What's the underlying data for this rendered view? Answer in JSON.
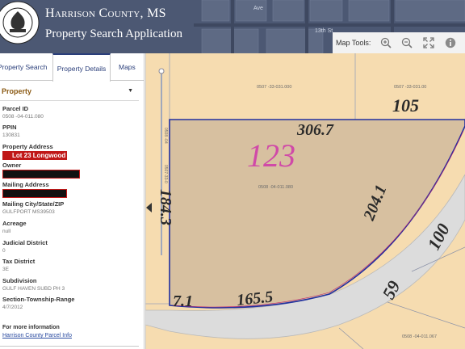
{
  "header": {
    "title": "Harrison County, MS",
    "subtitle": "Property Search Application",
    "seal_text": "BOARD OF SUPERVISORS · HARRISON COUNTY",
    "street_label": "13th St",
    "avenue_label": "Ave"
  },
  "map_tools": {
    "label": "Map Tools:",
    "icons": [
      "zoom-in-icon",
      "zoom-out-icon",
      "full-extent-icon",
      "info-icon"
    ]
  },
  "tabs": [
    "Property Search",
    "Property Details",
    "Maps"
  ],
  "active_tab": "Property Details",
  "section": {
    "title": "Property"
  },
  "fields": {
    "parcel_id": {
      "label": "Parcel ID",
      "value": "0508 -04-011.080"
    },
    "ppin": {
      "label": "PPIN",
      "value": "130831"
    },
    "property_address": {
      "label": "Property Address",
      "value": "Lot 23 Longwood"
    },
    "owner": {
      "label": "Owner"
    },
    "mailing_address": {
      "label": "Mailing Address"
    },
    "mailing_city": {
      "label": "Mailing City/State/ZIP",
      "value": "GULFPORT MS39503"
    },
    "acreage": {
      "label": "Acreage",
      "value": "null"
    },
    "judicial_district": {
      "label": "Judicial District",
      "value": "0"
    },
    "tax_district": {
      "label": "Tax District",
      "value": "3E"
    },
    "subdivision": {
      "label": "Subdivision",
      "value": "GULF HAVEN SUBD PH 3"
    },
    "section_township_range": {
      "label": "Section-Township-Range",
      "value": "4/7/2012"
    }
  },
  "more_info": {
    "label": "For more information",
    "link": "Harrison County Parcel Info"
  },
  "map": {
    "lot_number": "123",
    "dim_top": "306.7",
    "dim_left": "184.3",
    "dim_curve_right": "204.1",
    "dim_bottom": "165.5",
    "dim_corner": "7.1",
    "lot_105": "105",
    "lot_100": "100",
    "lot_59": "59",
    "parcel_top_left": "0507 -33-031.000",
    "parcel_top_right": "0507 -33-031.00",
    "parcel_center": "0508 -04-011.080",
    "parcel_bottom": "0508 -04-011.067",
    "left_edge_label_1": "0507-33-0",
    "left_edge_label_2": "0508 -04"
  },
  "colors": {
    "header_bg": "#4a5670",
    "parcel_fill": "#f6dcb0",
    "selected_fill": "#d7c0a0",
    "selected_outline": "#2030a0",
    "road": "#dcdcdc",
    "lot_number": "#d04aa8",
    "redaction": "#c01818"
  }
}
